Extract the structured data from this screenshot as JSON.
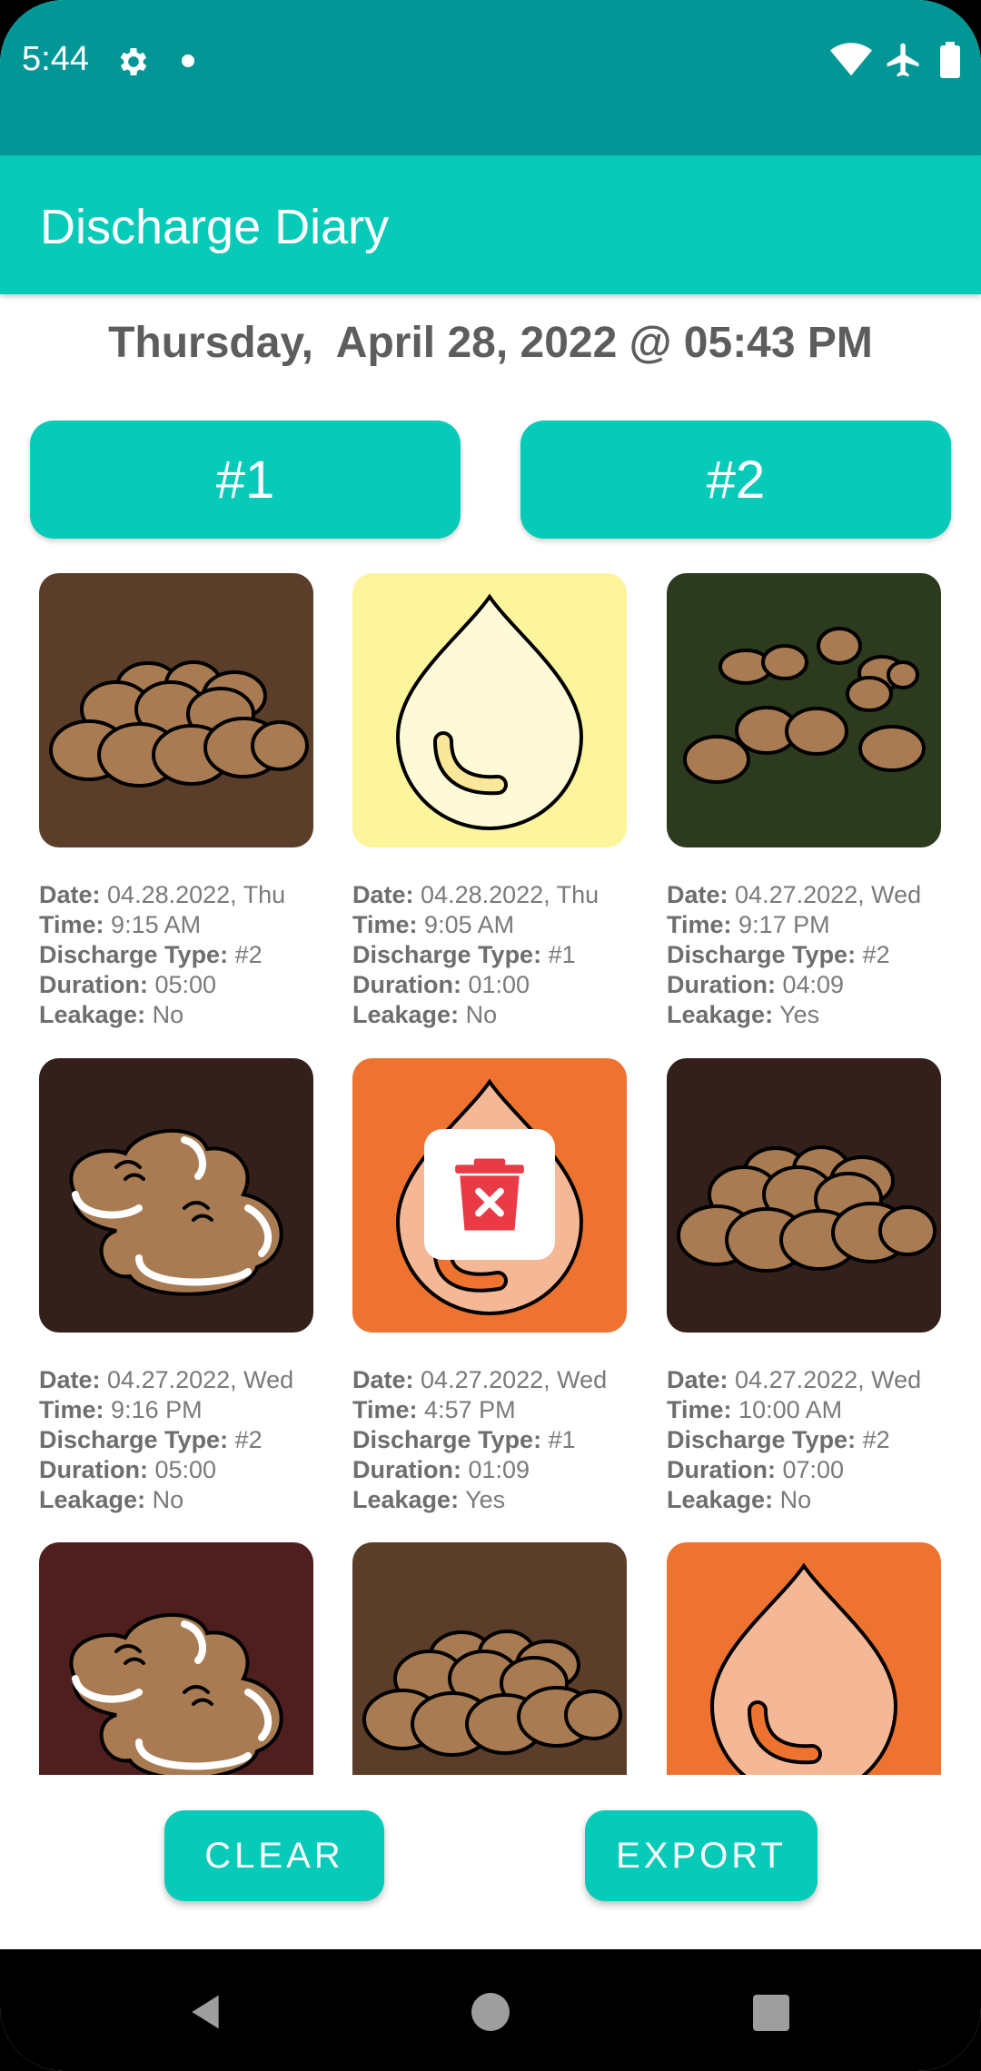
{
  "status_bar": {
    "time": "5:44",
    "icons": [
      "gear-icon",
      "notification-dot",
      "wifi-icon",
      "airplane-icon",
      "battery-icon"
    ]
  },
  "app_bar": {
    "title": "Discharge Diary"
  },
  "datetime": "Thursday,  April 28, 2022 @ 05:43 PM",
  "type_buttons": {
    "type1_label": "#1",
    "type2_label": "#2"
  },
  "labels": {
    "date": "Date:",
    "time": "Time:",
    "type": "Discharge Type:",
    "duration": "Duration:",
    "leakage": "Leakage:"
  },
  "entries": [
    {
      "icon": "lumpy-stool-icon",
      "bg": "#5b3e2a",
      "date": "04.28.2022, Thu",
      "time": "9:15 AM",
      "type": "#2",
      "duration": "05:00",
      "leakage": "No"
    },
    {
      "icon": "urine-drop-icon",
      "bg": "#fdf59c",
      "date": "04.28.2022, Thu",
      "time": "9:05 AM",
      "type": "#1",
      "duration": "01:00",
      "leakage": "No"
    },
    {
      "icon": "pebble-stool-icon",
      "bg": "#2c3a1e",
      "date": "04.27.2022, Wed",
      "time": "9:17 PM",
      "type": "#2",
      "duration": "04:09",
      "leakage": "Yes"
    },
    {
      "icon": "soft-stool-icon",
      "bg": "#33201a",
      "date": "04.27.2022, Wed",
      "time": "9:16 PM",
      "type": "#2",
      "duration": "05:00",
      "leakage": "No"
    },
    {
      "icon": "urine-drop-icon",
      "bg": "#ee7330",
      "date": "04.27.2022, Wed",
      "time": "4:57 PM",
      "type": "#1",
      "duration": "01:09",
      "leakage": "Yes"
    },
    {
      "icon": "lumpy-stool-icon",
      "bg": "#33201a",
      "date": "04.27.2022, Wed",
      "time": "10:00 AM",
      "type": "#2",
      "duration": "07:00",
      "leakage": "No"
    },
    {
      "icon": "soft-stool-icon",
      "bg": "#4f1f1f"
    },
    {
      "icon": "lumpy-stool-icon",
      "bg": "#5b3e2a"
    },
    {
      "icon": "urine-drop-icon",
      "bg": "#ee7330"
    }
  ],
  "delete_overlay_icon": "trash-delete-icon",
  "buttons": {
    "clear": "CLEAR",
    "export": "EXPORT"
  },
  "colors": {
    "status_bar": "#029796",
    "accent": "#07cab9",
    "delete_red": "#e93a45"
  }
}
